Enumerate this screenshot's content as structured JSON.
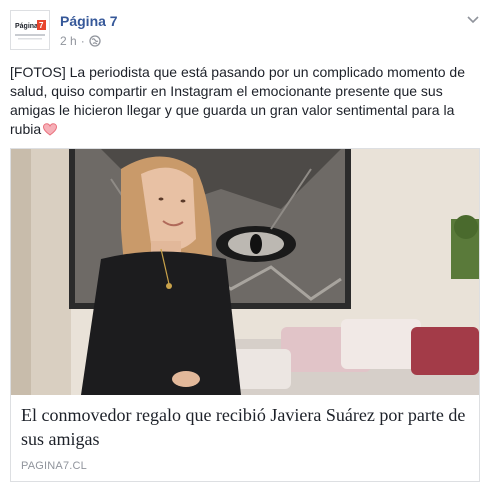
{
  "post": {
    "page_name": "Página 7",
    "avatar_label": "Página 7",
    "timestamp": "2 h",
    "separator": "·",
    "privacy_icon": "globe-icon",
    "menu_icon": "chevron-down-icon",
    "text": "[FOTOS] La periodista que está pasando por un complicado momento de salud, quiso compartir en Instagram el emocionante presente que sus amigas le hicieron llegar y que guarda un gran valor sentimental para la rubia",
    "emoji": "heart-icon"
  },
  "link": {
    "title": "El conmovedor regalo que recibió Javiera Suárez por parte de sus amigas",
    "domain": "PAGINA7.CL"
  },
  "colors": {
    "link_blue": "#365899",
    "meta_gray": "#90949c",
    "heart_pink": "#e9707c",
    "avatar_red": "#e8442d"
  }
}
